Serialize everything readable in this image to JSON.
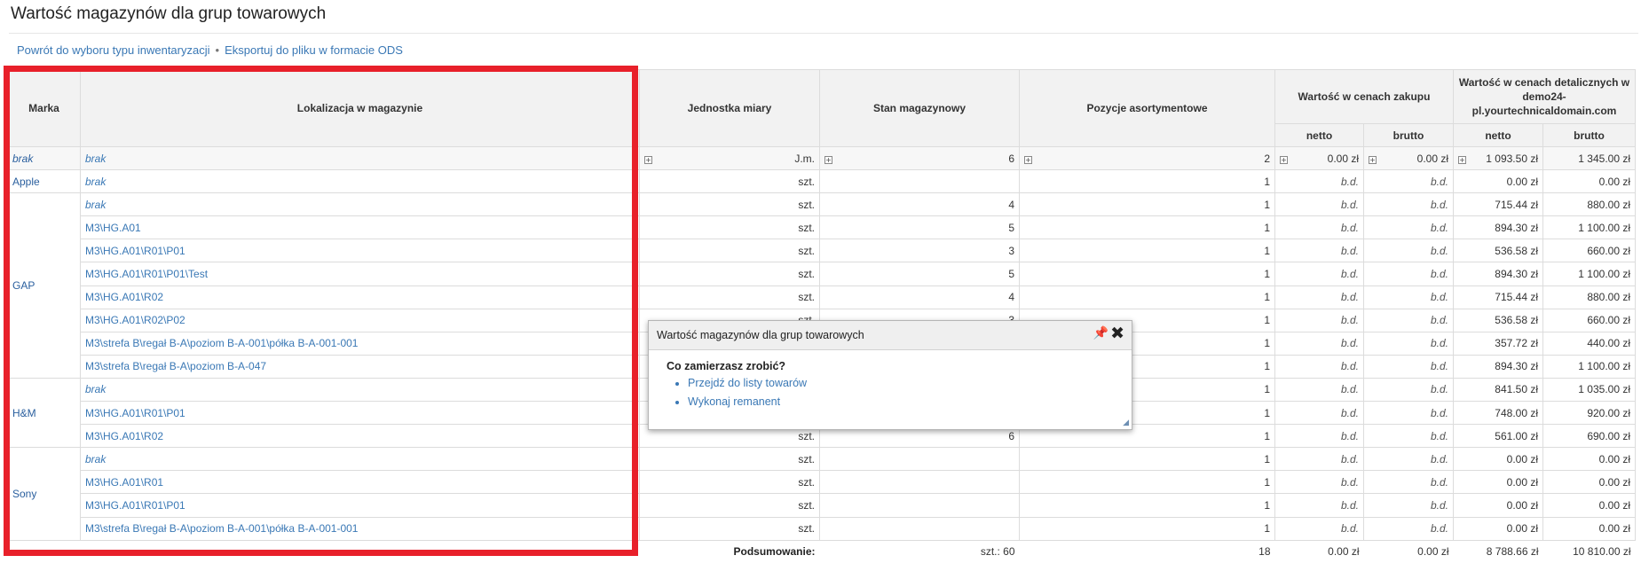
{
  "page": {
    "title": "Wartość magazynów dla grup towarowych"
  },
  "links": {
    "back": "Powrót do wyboru typu inwentaryzacji",
    "separator": "•",
    "export": "Eksportuj do pliku w formacie ODS"
  },
  "table": {
    "headers": {
      "brand": "Marka",
      "location": "Lokalizacja w magazynie",
      "unit": "Jednostka miary",
      "stock": "Stan magazynowy",
      "positions": "Pozycje asortymentowe",
      "purchase": "Wartość w cenach zakupu",
      "retail": "Wartość w cenach detalicznych w demo24-pl.yourtechnicaldomain.com",
      "net": "netto",
      "gross": "brutto"
    },
    "expand_icon": "+",
    "first_row": {
      "brand": "brak",
      "location": "brak",
      "unit": "J.m.",
      "stock": "6",
      "positions": "2",
      "p_net": "0.00 zł",
      "p_gross": "0.00 zł",
      "r_net": "1 093.50 zł",
      "r_gross": "1 345.00 zł"
    },
    "groups": [
      {
        "brand": "Apple",
        "rows": [
          {
            "location": "brak",
            "italic": true,
            "unit": "szt.",
            "stock": "",
            "positions": "1",
            "p_net": "b.d.",
            "p_gross": "b.d.",
            "r_net": "0.00 zł",
            "r_gross": "0.00 zł"
          }
        ]
      },
      {
        "brand": "GAP",
        "rows": [
          {
            "location": "brak",
            "italic": true,
            "unit": "szt.",
            "stock": "4",
            "positions": "1",
            "p_net": "b.d.",
            "p_gross": "b.d.",
            "r_net": "715.44 zł",
            "r_gross": "880.00 zł"
          },
          {
            "location": "M3\\HG.A01",
            "unit": "szt.",
            "stock": "5",
            "positions": "1",
            "p_net": "b.d.",
            "p_gross": "b.d.",
            "r_net": "894.30 zł",
            "r_gross": "1 100.00 zł"
          },
          {
            "location": "M3\\HG.A01\\R01\\P01",
            "unit": "szt.",
            "stock": "3",
            "positions": "1",
            "p_net": "b.d.",
            "p_gross": "b.d.",
            "r_net": "536.58 zł",
            "r_gross": "660.00 zł"
          },
          {
            "location": "M3\\HG.A01\\R01\\P01\\Test",
            "unit": "szt.",
            "stock": "5",
            "positions": "1",
            "p_net": "b.d.",
            "p_gross": "b.d.",
            "r_net": "894.30 zł",
            "r_gross": "1 100.00 zł"
          },
          {
            "location": "M3\\HG.A01\\R02",
            "unit": "szt.",
            "stock": "4",
            "positions": "1",
            "p_net": "b.d.",
            "p_gross": "b.d.",
            "r_net": "715.44 zł",
            "r_gross": "880.00 zł"
          },
          {
            "location": "M3\\HG.A01\\R02\\P02",
            "unit": "szt.",
            "stock": "3",
            "positions": "1",
            "p_net": "b.d.",
            "p_gross": "b.d.",
            "r_net": "536.58 zł",
            "r_gross": "660.00 zł"
          },
          {
            "location": "M3\\strefa B\\regał B-A\\poziom B-A-001\\półka B-A-001-001",
            "unit": "",
            "stock": "",
            "positions": "1",
            "p_net": "b.d.",
            "p_gross": "b.d.",
            "r_net": "357.72 zł",
            "r_gross": "440.00 zł"
          },
          {
            "location": "M3\\strefa B\\regał B-A\\poziom B-A-047",
            "unit": "",
            "stock": "",
            "positions": "1",
            "p_net": "b.d.",
            "p_gross": "b.d.",
            "r_net": "894.30 zł",
            "r_gross": "1 100.00 zł"
          }
        ]
      },
      {
        "brand": "H&M",
        "rows": [
          {
            "location": "brak",
            "italic": true,
            "unit": "",
            "stock": "",
            "positions": "1",
            "p_net": "b.d.",
            "p_gross": "b.d.",
            "r_net": "841.50 zł",
            "r_gross": "1 035.00 zł"
          },
          {
            "location": "M3\\HG.A01\\R01\\P01",
            "unit": "",
            "stock": "",
            "positions": "1",
            "p_net": "b.d.",
            "p_gross": "b.d.",
            "r_net": "748.00 zł",
            "r_gross": "920.00 zł"
          },
          {
            "location": "M3\\HG.A01\\R02",
            "unit": "szt.",
            "stock": "6",
            "positions": "1",
            "p_net": "b.d.",
            "p_gross": "b.d.",
            "r_net": "561.00 zł",
            "r_gross": "690.00 zł"
          }
        ]
      },
      {
        "brand": "Sony",
        "rows": [
          {
            "location": "brak",
            "italic": true,
            "unit": "szt.",
            "stock": "",
            "positions": "1",
            "p_net": "b.d.",
            "p_gross": "b.d.",
            "r_net": "0.00 zł",
            "r_gross": "0.00 zł"
          },
          {
            "location": "M3\\HG.A01\\R01",
            "unit": "szt.",
            "stock": "",
            "positions": "1",
            "p_net": "b.d.",
            "p_gross": "b.d.",
            "r_net": "0.00 zł",
            "r_gross": "0.00 zł"
          },
          {
            "location": "M3\\HG.A01\\R01\\P01",
            "unit": "szt.",
            "stock": "",
            "positions": "1",
            "p_net": "b.d.",
            "p_gross": "b.d.",
            "r_net": "0.00 zł",
            "r_gross": "0.00 zł"
          },
          {
            "location": "M3\\strefa B\\regał B-A\\poziom B-A-001\\półka B-A-001-001",
            "unit": "szt.",
            "stock": "",
            "positions": "1",
            "p_net": "b.d.",
            "p_gross": "b.d.",
            "r_net": "0.00 zł",
            "r_gross": "0.00 zł"
          }
        ]
      }
    ],
    "summary": {
      "label": "Podsumowanie:",
      "stock": "szt.: 60",
      "positions": "18",
      "p_net": "0.00 zł",
      "p_gross": "0.00 zł",
      "r_net": "8 788.66 zł",
      "r_gross": "10 810.00 zł"
    }
  },
  "dialog": {
    "title": "Wartość magazynów dla grup towarowych",
    "question": "Co zamierzasz zrobić?",
    "options": [
      "Przejdź do listy towarów",
      "Wykonaj remanent"
    ],
    "pin_icon": "📌",
    "close_icon": "✖",
    "resize_icon": "◢"
  },
  "colors": {
    "highlight": "#e8202a",
    "link": "#3a78b5"
  }
}
